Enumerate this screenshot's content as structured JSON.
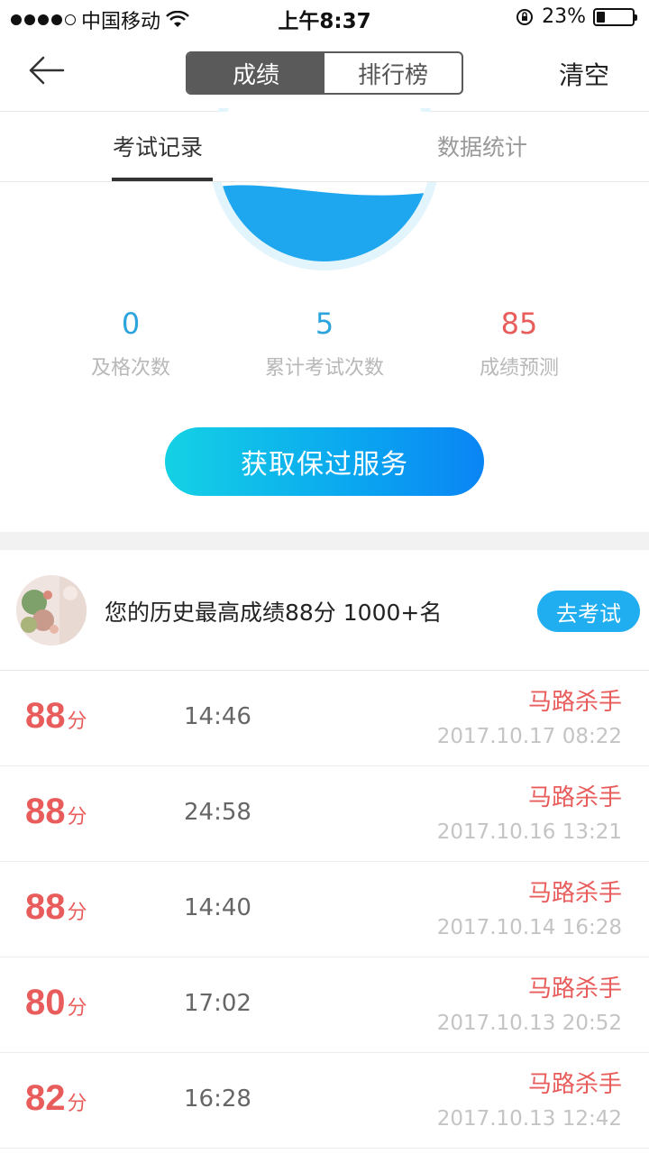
{
  "status_bar": {
    "carrier": "中国移动",
    "time": "上午8:37",
    "battery": "23%",
    "battery_level": 0.23
  },
  "nav": {
    "segments": [
      "成绩",
      "排行榜"
    ],
    "active_segment": 0,
    "clear_label": "清空"
  },
  "tabs": [
    {
      "label": "考试记录",
      "active": true
    },
    {
      "label": "数据统计",
      "active": false
    }
  ],
  "stats": [
    {
      "value": "0",
      "label": "及格次数",
      "color": "#2ba3dd"
    },
    {
      "value": "5",
      "label": "累计考试次数",
      "color": "#2ba3dd"
    },
    {
      "value": "85",
      "label": "成绩预测",
      "color": "#e95c5c"
    }
  ],
  "service_button": "获取保过服务",
  "best": {
    "text": "您的历史最高成绩88分 1000+名",
    "button": "去考试"
  },
  "records": [
    {
      "score": "88",
      "unit": "分",
      "duration": "14:46",
      "nickname": "马路杀手",
      "datetime": "2017.10.17 08:22"
    },
    {
      "score": "88",
      "unit": "分",
      "duration": "24:58",
      "nickname": "马路杀手",
      "datetime": "2017.10.16 13:21"
    },
    {
      "score": "88",
      "unit": "分",
      "duration": "14:40",
      "nickname": "马路杀手",
      "datetime": "2017.10.14 16:28"
    },
    {
      "score": "80",
      "unit": "分",
      "duration": "17:02",
      "nickname": "马路杀手",
      "datetime": "2017.10.13 20:52"
    },
    {
      "score": "82",
      "unit": "分",
      "duration": "16:28",
      "nickname": "马路杀手",
      "datetime": "2017.10.13 12:42"
    }
  ],
  "colors": {
    "accent_blue": "#21aef0",
    "score_red": "#e95c5c",
    "segment_gray": "#5a5a5a"
  }
}
